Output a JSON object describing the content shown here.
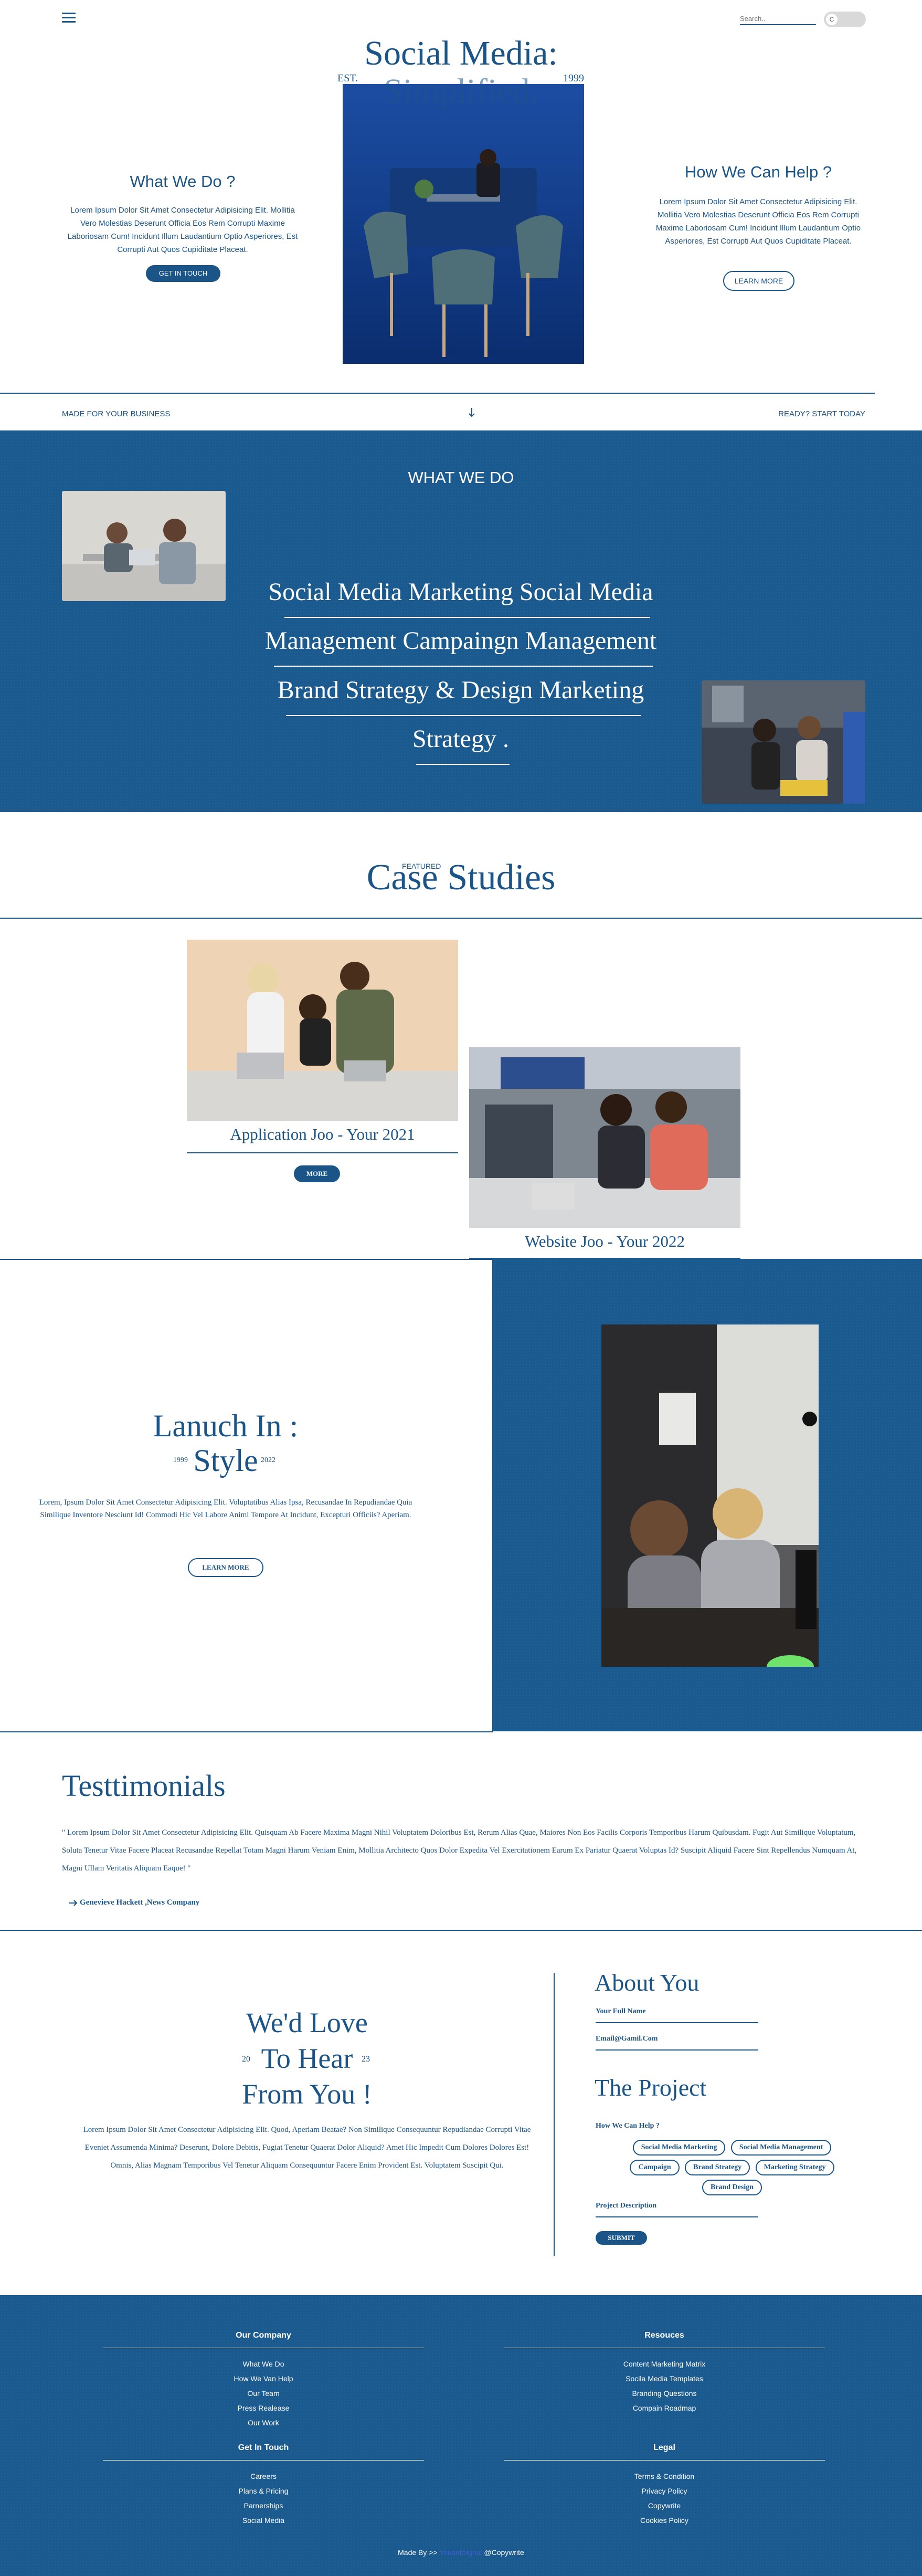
{
  "header": {
    "menu_icon": "hamburger-icon",
    "search_placeholder": "Search..",
    "toggle_label": "C"
  },
  "hero": {
    "title_line1": "Social Media:",
    "title_line2": "Simplified.",
    "est_label": "EST.",
    "year": "1999",
    "left_heading": "What We Do ?",
    "left_text": "Lorem Ipsum Dolor Sit Amet Consectetur Adipisicing Elit. Mollitia Vero Molestias Deserunt Officia Eos Rem Corrupti Maxime Laboriosam Cum! Incidunt Illum Laudantium Optio Asperiores, Est Corrupti Aut Quos Cupiditate Placeat.",
    "left_button": "GET IN TOUCH",
    "right_heading": "How We Can Help ?",
    "right_text": "Lorem Ipsum Dolor Sit Amet Consectetur Adipisicing Elit. Mollitia Vero Molestias Deserunt Officia Eos Rem Corrupti Maxime Laboriosam Cum! Incidunt Illum Laudantium Optio Asperiores, Est Corrupti Aut Quos Cupiditate Placeat.",
    "right_button": "LEARN MORE"
  },
  "strip": {
    "left": "MADE FOR YOUR BUSINESS",
    "arrow_icon": "arrow-down-icon",
    "right": "READY? START TODAY"
  },
  "services": {
    "heading": "WHAT WE DO",
    "lines": [
      "Social Media Marketing Social Media",
      "Management Campaingn Management",
      "Brand Strategy & Design Marketing",
      "Strategy ."
    ]
  },
  "case_studies": {
    "kicker": "FEATURED",
    "title": "Case Studies",
    "card1_title": "Application Joo - Your 2021",
    "card1_button": "MORE",
    "card2_title": "Website Joo - Your 2022"
  },
  "launch": {
    "title_line1": "Lanuch In :",
    "year_left": "1999",
    "title_line2": "Style",
    "year_right": "2022",
    "text": "Lorem, Ipsum Dolor Sit Amet Consectetur Adipisicing Elit. Voluptatibus Alias Ipsa, Recusandae In Repudiandae Quia Similique Inventore Nesciunt Id! Commodi Hic Vel Labore Animi Tempore At Incidunt, Excepturi Officiis? Aperiam.",
    "button": "LEARN MORE"
  },
  "testimonials": {
    "title": "Testtimonials",
    "quote": "\" Lorem Ipsum Dolor Sit Amet Consectetur Adipisicing Elit. Quisquam Ab Facere Maxima Magni Nihil Voluptatem Doloribus Est, Rerum Alias Quae, Maiores Non Eos Facilis Corporis Temporibus Harum Quibusdam. Fugit Aut Similique Voluptatum, Soluta Tenetur Vitae Facere Placeat Recusandae Repellat Totam Magni Harum Veniam Enim, Mollitia Architecto Quos Dolor Expedita Vel Exercitationem Earum Ex Pariatur Quaerat Voluptas Id? Suscipit Aliquid Facere Sint Repellendus Numquam At, Magni Ullam Veritatis Aliquam Eaque! \"",
    "author": "Genevieve Hackett ,News Company",
    "arrow_icon": "arrow-right-icon"
  },
  "contact": {
    "title_line1": "We'd Love",
    "year_left": "20",
    "title_line2": "To Hear",
    "year_right": "23",
    "title_line3": "From You !",
    "text": "Lorem Ipsum Dolor Sit Amet Consectetur Adipisicing Elit. Quod, Aperiam Beatae? Non Similique Consequuntur Repudiandae Corrupti Vitae Eveniet Assumenda Minima? Deserunt, Dolore Debitis, Fugiat Tenetur Quaerat Dolor Aliquid? Amet Hic Impedit Cum Dolores Dolores Est! Omnis, Alias Magnam Temporibus Vel Tenetur Aliquam Consequuntur Facere Enim Provident Est. Voluptatem Suscipit Qui.",
    "about_title": "About You",
    "full_name_label": "Your Full Name",
    "email_label": "Email@Gamil.Com",
    "project_title": "The Project",
    "help_label": "How We Can Help ?",
    "options": [
      "Social Media Marketing",
      "Social Media Management",
      "Campaign",
      "Brand Strategy",
      "Marketing Strategy",
      "Brand Design"
    ],
    "description_label": "Project Description",
    "submit": "SUBMIT"
  },
  "footer": {
    "company_heading": "Our Company",
    "company_links": [
      "What We Do",
      "How We Van Help",
      "Our Team",
      "Press Realease",
      "Our Work"
    ],
    "resources_heading": "Resouces",
    "resources_links": [
      "Content Marketing Matrix",
      "Socila Media Templates",
      "Branding Questions",
      "Compain Roadmap"
    ],
    "touch_heading": "Get In Touch",
    "touch_links": [
      "Careers",
      "Plans & Pricing",
      "Parnerships",
      "Social Media"
    ],
    "legal_heading": "Legal",
    "legal_links": [
      "Terms & Condition",
      "Privacy Policy",
      "Copywrite",
      "Cookies Policy"
    ],
    "credit_prefix": "Made By >>",
    "credit_name": "YousefAlghul",
    "credit_suffix": "@Copywrite"
  },
  "colors": {
    "brand_blue": "#1b5588",
    "section_blue": "#1a5a8f",
    "accent_green": "#6fe36a"
  }
}
